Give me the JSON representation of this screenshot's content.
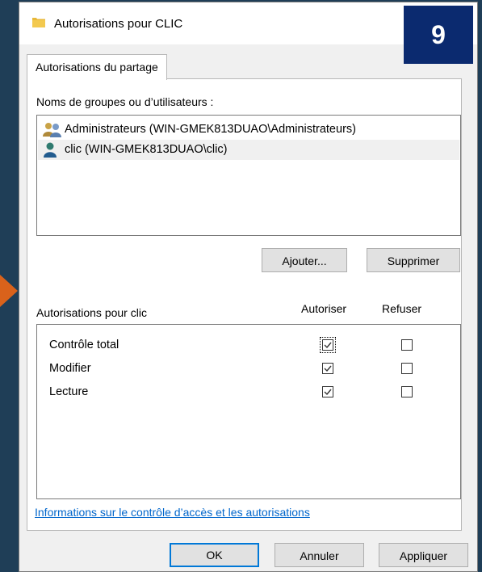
{
  "window": {
    "title": "Autorisations pour CLIC",
    "step_badge": "9"
  },
  "tabs": [
    {
      "label": "Autorisations du partage"
    }
  ],
  "users": {
    "label": "Noms de groupes ou d’utilisateurs :",
    "items": [
      {
        "name": "Administrateurs (WIN-GMEK813DUAO\\Administrateurs)",
        "icon": "group-icon",
        "selected": false
      },
      {
        "name": "clic (WIN-GMEK813DUAO\\clic)",
        "icon": "user-icon",
        "selected": true
      }
    ],
    "add_label": "Ajouter...",
    "remove_label": "Supprimer"
  },
  "permissions": {
    "label": "Autorisations pour clic",
    "allow_header": "Autoriser",
    "deny_header": "Refuser",
    "rows": [
      {
        "name": "Contrôle total",
        "allow": true,
        "deny": false
      },
      {
        "name": "Modifier",
        "allow": true,
        "deny": false
      },
      {
        "name": "Lecture",
        "allow": true,
        "deny": false
      }
    ]
  },
  "link": "Informations sur le contrôle d’accès et les autorisations",
  "footer": {
    "ok": "OK",
    "cancel": "Annuler",
    "apply": "Appliquer"
  },
  "colors": {
    "background": "#1f3e57",
    "arrow": "#d9621b",
    "badge": "#0b2a6f",
    "link": "#0066cc",
    "default_button_border": "#0078d7"
  }
}
